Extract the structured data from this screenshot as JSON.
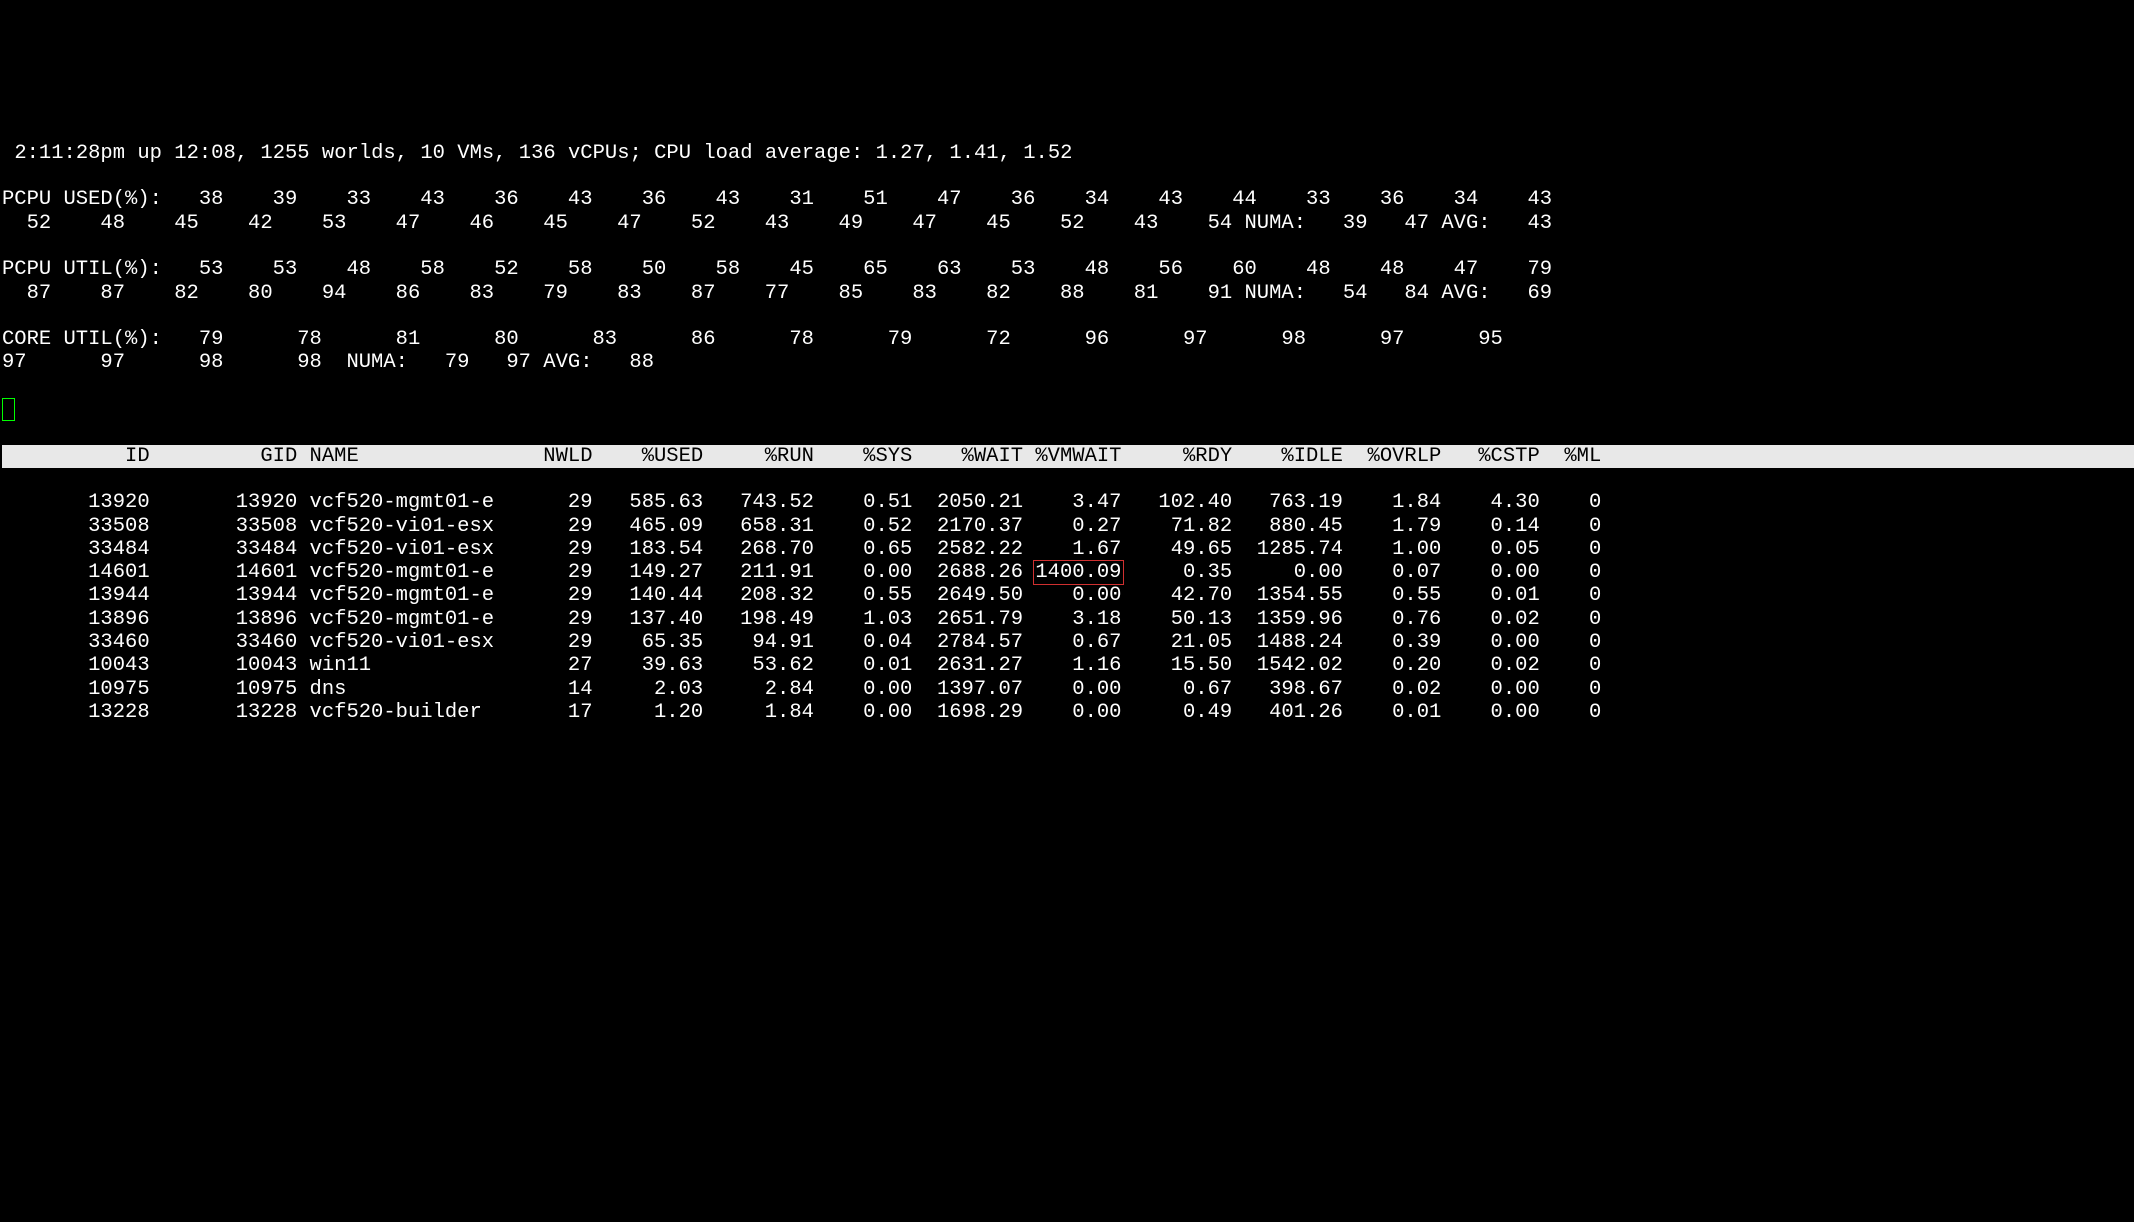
{
  "summary": {
    "time": "2:11:28pm",
    "up_label": "up",
    "uptime": "12:08",
    "worlds_count": "1255",
    "worlds_label": "worlds",
    "vms_count": "10",
    "vms_label": "VMs",
    "vcpus_count": "136",
    "vcpus_label": "vCPUs",
    "load_label": "CPU load average:",
    "load1": "1.27",
    "load5": "1.41",
    "load15": "1.52"
  },
  "pcpu_used": {
    "label": "PCPU USED(%):",
    "vals": [
      "38",
      "39",
      "33",
      "43",
      "36",
      "43",
      "36",
      "43",
      "31",
      "51",
      "47",
      "36",
      "34",
      "43",
      "44",
      "33",
      "36",
      "34",
      "43",
      "52",
      "48",
      "45",
      "42",
      "53",
      "47",
      "46",
      "45",
      "47",
      "52",
      "43",
      "49",
      "47",
      "45",
      "52",
      "43",
      "54"
    ],
    "numa_label": "NUMA:",
    "numa1": "39",
    "numa2": "47",
    "avg_label": "AVG:",
    "avg": "43"
  },
  "pcpu_util": {
    "label": "PCPU UTIL(%):",
    "vals": [
      "53",
      "53",
      "48",
      "58",
      "52",
      "58",
      "50",
      "58",
      "45",
      "65",
      "63",
      "53",
      "48",
      "56",
      "60",
      "48",
      "48",
      "47",
      "79",
      "87",
      "87",
      "82",
      "80",
      "94",
      "86",
      "83",
      "79",
      "83",
      "87",
      "77",
      "85",
      "83",
      "82",
      "88",
      "81",
      "91"
    ],
    "numa_label": "NUMA:",
    "numa1": "54",
    "numa2": "84",
    "avg_label": "AVG:",
    "avg": "69"
  },
  "core_util": {
    "label": "CORE UTIL(%):",
    "vals": [
      "79",
      "78",
      "81",
      "80",
      "83",
      "86",
      "78",
      "79",
      "72",
      "96",
      "97",
      "98",
      "97",
      "95",
      "97",
      "97",
      "98",
      "98"
    ],
    "numa_label": "NUMA:",
    "numa1": "79",
    "numa2": "97",
    "avg_label": "AVG:",
    "avg": "88"
  },
  "columns": [
    "ID",
    "GID",
    "NAME",
    "NWLD",
    "%USED",
    "%RUN",
    "%SYS",
    "%WAIT",
    "%VMWAIT",
    "%RDY",
    "%IDLE",
    "%OVRLP",
    "%CSTP",
    "%ML"
  ],
  "rows": [
    {
      "id": "13920",
      "gid": "13920",
      "name": "vcf520-mgmt01-e",
      "nwld": "29",
      "used": "585.63",
      "run": "743.52",
      "sys": "0.51",
      "wait": "2050.21",
      "vmwait": "3.47",
      "rdy": "102.40",
      "idle": "763.19",
      "ovrlp": "1.84",
      "cstp": "4.30",
      "ml": "0"
    },
    {
      "id": "33508",
      "gid": "33508",
      "name": "vcf520-vi01-esx",
      "nwld": "29",
      "used": "465.09",
      "run": "658.31",
      "sys": "0.52",
      "wait": "2170.37",
      "vmwait": "0.27",
      "rdy": "71.82",
      "idle": "880.45",
      "ovrlp": "1.79",
      "cstp": "0.14",
      "ml": "0"
    },
    {
      "id": "33484",
      "gid": "33484",
      "name": "vcf520-vi01-esx",
      "nwld": "29",
      "used": "183.54",
      "run": "268.70",
      "sys": "0.65",
      "wait": "2582.22",
      "vmwait": "1.67",
      "rdy": "49.65",
      "idle": "1285.74",
      "ovrlp": "1.00",
      "cstp": "0.05",
      "ml": "0"
    },
    {
      "id": "14601",
      "gid": "14601",
      "name": "vcf520-mgmt01-e",
      "nwld": "29",
      "used": "149.27",
      "run": "211.91",
      "sys": "0.00",
      "wait": "2688.26",
      "vmwait": "1400.09",
      "vmwait_hl": true,
      "rdy": "0.35",
      "idle": "0.00",
      "ovrlp": "0.07",
      "cstp": "0.00",
      "ml": "0"
    },
    {
      "id": "13944",
      "gid": "13944",
      "name": "vcf520-mgmt01-e",
      "nwld": "29",
      "used": "140.44",
      "run": "208.32",
      "sys": "0.55",
      "wait": "2649.50",
      "vmwait": "0.00",
      "rdy": "42.70",
      "idle": "1354.55",
      "ovrlp": "0.55",
      "cstp": "0.01",
      "ml": "0"
    },
    {
      "id": "13896",
      "gid": "13896",
      "name": "vcf520-mgmt01-e",
      "nwld": "29",
      "used": "137.40",
      "run": "198.49",
      "sys": "1.03",
      "wait": "2651.79",
      "vmwait": "3.18",
      "rdy": "50.13",
      "idle": "1359.96",
      "ovrlp": "0.76",
      "cstp": "0.02",
      "ml": "0"
    },
    {
      "id": "33460",
      "gid": "33460",
      "name": "vcf520-vi01-esx",
      "nwld": "29",
      "used": "65.35",
      "run": "94.91",
      "sys": "0.04",
      "wait": "2784.57",
      "vmwait": "0.67",
      "rdy": "21.05",
      "idle": "1488.24",
      "ovrlp": "0.39",
      "cstp": "0.00",
      "ml": "0"
    },
    {
      "id": "10043",
      "gid": "10043",
      "name": "win11",
      "nwld": "27",
      "used": "39.63",
      "run": "53.62",
      "sys": "0.01",
      "wait": "2631.27",
      "vmwait": "1.16",
      "rdy": "15.50",
      "idle": "1542.02",
      "ovrlp": "0.20",
      "cstp": "0.02",
      "ml": "0"
    },
    {
      "id": "10975",
      "gid": "10975",
      "name": "dns",
      "nwld": "14",
      "used": "2.03",
      "run": "2.84",
      "sys": "0.00",
      "wait": "1397.07",
      "vmwait": "0.00",
      "rdy": "0.67",
      "idle": "398.67",
      "ovrlp": "0.02",
      "cstp": "0.00",
      "ml": "0"
    },
    {
      "id": "13228",
      "gid": "13228",
      "name": "vcf520-builder",
      "nwld": "17",
      "used": "1.20",
      "run": "1.84",
      "sys": "0.00",
      "wait": "1698.29",
      "vmwait": "0.00",
      "rdy": "0.49",
      "idle": "401.26",
      "ovrlp": "0.01",
      "cstp": "0.00",
      "ml": "0"
    }
  ]
}
